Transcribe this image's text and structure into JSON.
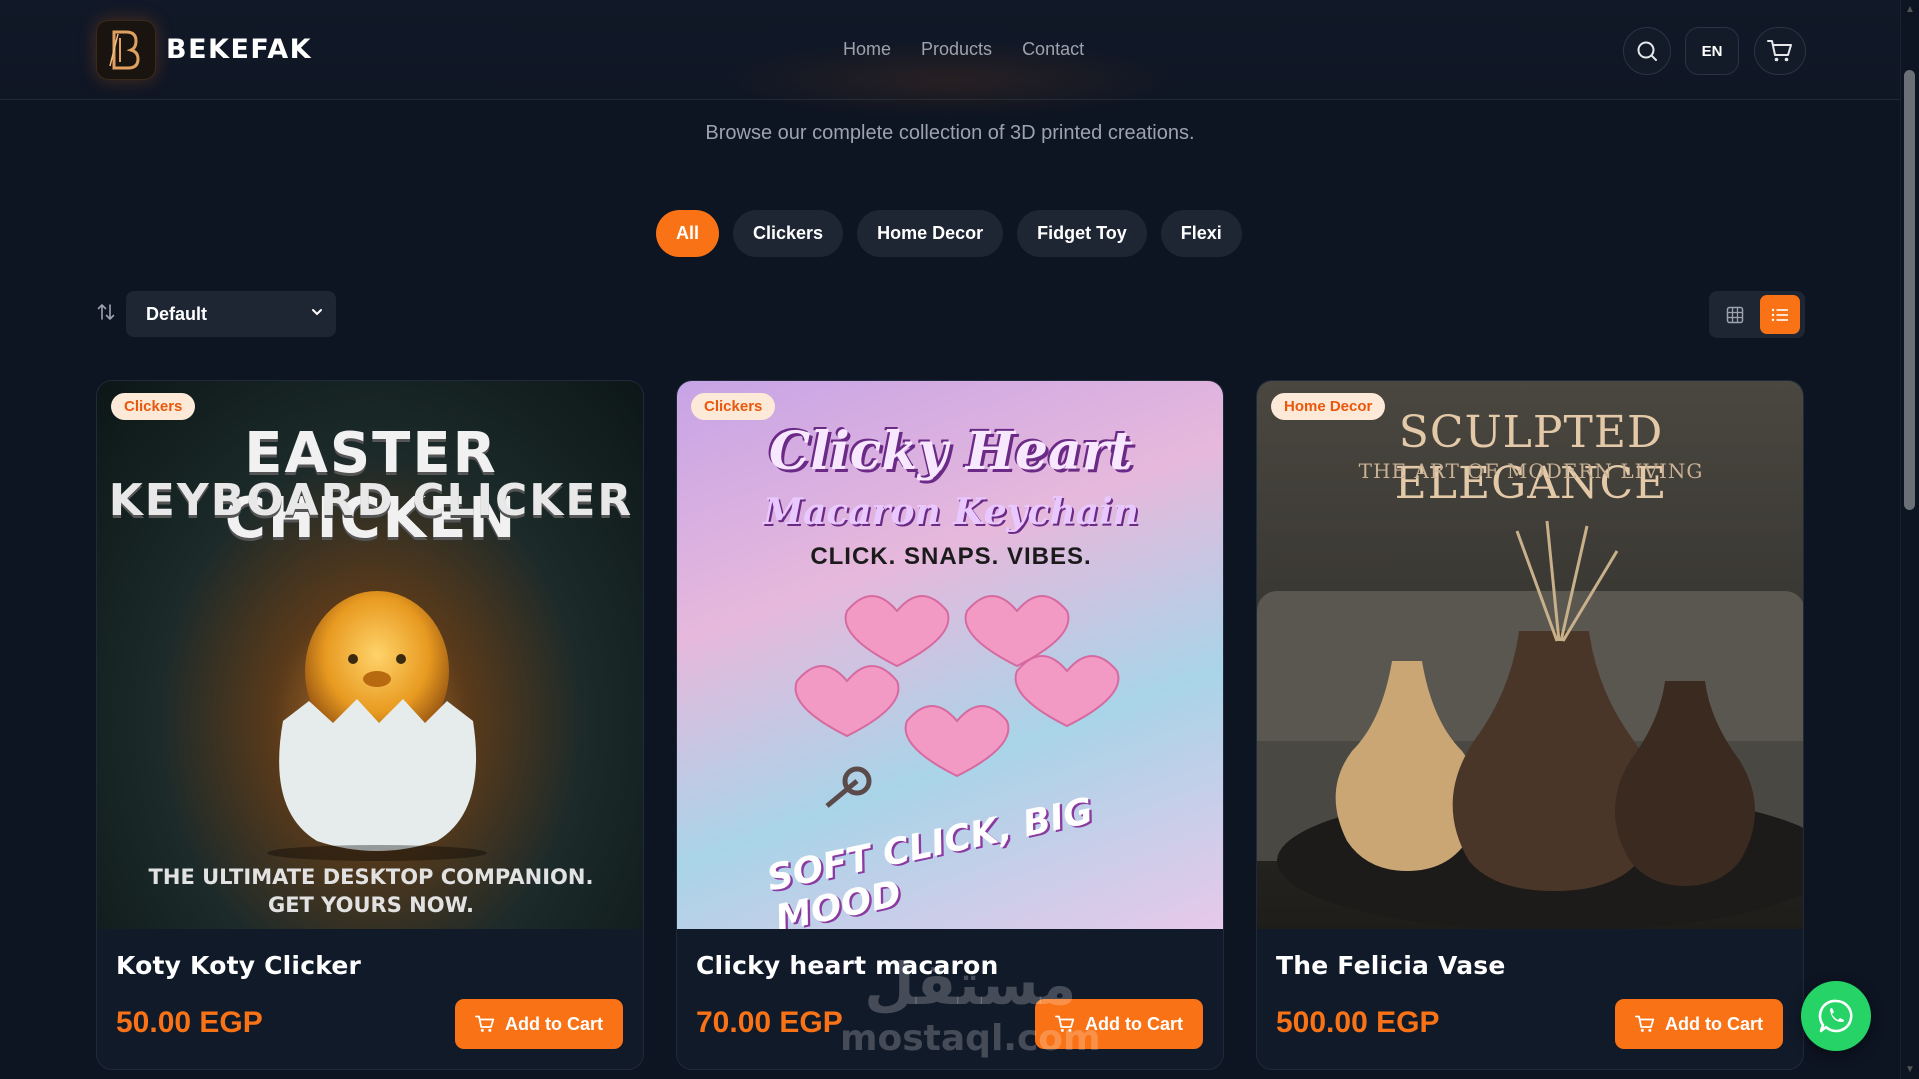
{
  "header": {
    "brand": "BEKEFAK",
    "nav": [
      "Home",
      "Products",
      "Contact"
    ],
    "lang": "EN"
  },
  "page": {
    "subtitle": "Browse our complete collection of 3D printed creations."
  },
  "filters": {
    "categories": [
      "All",
      "Clickers",
      "Home Decor",
      "Fidget Toy",
      "Flexi"
    ],
    "active": "All"
  },
  "sort": {
    "value": "Default"
  },
  "view": {
    "active": "list"
  },
  "products": [
    {
      "badge": "Clickers",
      "name": "Koty Koty Clicker",
      "price": "50.00 EGP",
      "cta": "Add to Cart",
      "image_text": [
        "EASTER CHICKEN",
        "KEYBOARD CLICKER",
        "THE ULTIMATE DESKTOP COMPANION.",
        "GET YOURS NOW."
      ]
    },
    {
      "badge": "Clickers",
      "name": "Clicky heart macaron",
      "price": "70.00 EGP",
      "cta": "Add to Cart",
      "image_text": [
        "Clicky Heart",
        "Macaron Keychain",
        "CLICK. SNAPS. VIBES.",
        "SOFT CLICK, BIG MOOD"
      ]
    },
    {
      "badge": "Home Decor",
      "name": "The Felicia Vase",
      "price": "500.00 EGP",
      "cta": "Add to Cart",
      "image_text": [
        "SCULPTED ELEGANCE",
        "THE ART OF MODERN LIVING"
      ]
    }
  ],
  "watermark": {
    "arabic": "مستقل",
    "latin": "mostaql.com"
  },
  "colors": {
    "accent": "#f97316",
    "background": "#0d1422",
    "card": "#111a29",
    "whatsapp": "#25d366"
  }
}
